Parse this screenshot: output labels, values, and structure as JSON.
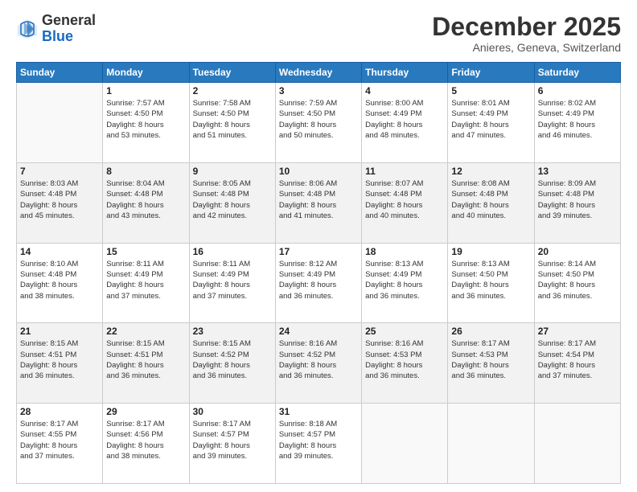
{
  "logo": {
    "general": "General",
    "blue": "Blue"
  },
  "title": "December 2025",
  "subtitle": "Anieres, Geneva, Switzerland",
  "days_header": [
    "Sunday",
    "Monday",
    "Tuesday",
    "Wednesday",
    "Thursday",
    "Friday",
    "Saturday"
  ],
  "weeks": [
    {
      "shaded": false,
      "days": [
        {
          "num": "",
          "empty": true
        },
        {
          "num": "1",
          "sunrise": "Sunrise: 7:57 AM",
          "sunset": "Sunset: 4:50 PM",
          "daylight": "Daylight: 8 hours",
          "daylight2": "and 53 minutes."
        },
        {
          "num": "2",
          "sunrise": "Sunrise: 7:58 AM",
          "sunset": "Sunset: 4:50 PM",
          "daylight": "Daylight: 8 hours",
          "daylight2": "and 51 minutes."
        },
        {
          "num": "3",
          "sunrise": "Sunrise: 7:59 AM",
          "sunset": "Sunset: 4:50 PM",
          "daylight": "Daylight: 8 hours",
          "daylight2": "and 50 minutes."
        },
        {
          "num": "4",
          "sunrise": "Sunrise: 8:00 AM",
          "sunset": "Sunset: 4:49 PM",
          "daylight": "Daylight: 8 hours",
          "daylight2": "and 48 minutes."
        },
        {
          "num": "5",
          "sunrise": "Sunrise: 8:01 AM",
          "sunset": "Sunset: 4:49 PM",
          "daylight": "Daylight: 8 hours",
          "daylight2": "and 47 minutes."
        },
        {
          "num": "6",
          "sunrise": "Sunrise: 8:02 AM",
          "sunset": "Sunset: 4:49 PM",
          "daylight": "Daylight: 8 hours",
          "daylight2": "and 46 minutes."
        }
      ]
    },
    {
      "shaded": true,
      "days": [
        {
          "num": "7",
          "sunrise": "Sunrise: 8:03 AM",
          "sunset": "Sunset: 4:48 PM",
          "daylight": "Daylight: 8 hours",
          "daylight2": "and 45 minutes."
        },
        {
          "num": "8",
          "sunrise": "Sunrise: 8:04 AM",
          "sunset": "Sunset: 4:48 PM",
          "daylight": "Daylight: 8 hours",
          "daylight2": "and 43 minutes."
        },
        {
          "num": "9",
          "sunrise": "Sunrise: 8:05 AM",
          "sunset": "Sunset: 4:48 PM",
          "daylight": "Daylight: 8 hours",
          "daylight2": "and 42 minutes."
        },
        {
          "num": "10",
          "sunrise": "Sunrise: 8:06 AM",
          "sunset": "Sunset: 4:48 PM",
          "daylight": "Daylight: 8 hours",
          "daylight2": "and 41 minutes."
        },
        {
          "num": "11",
          "sunrise": "Sunrise: 8:07 AM",
          "sunset": "Sunset: 4:48 PM",
          "daylight": "Daylight: 8 hours",
          "daylight2": "and 40 minutes."
        },
        {
          "num": "12",
          "sunrise": "Sunrise: 8:08 AM",
          "sunset": "Sunset: 4:48 PM",
          "daylight": "Daylight: 8 hours",
          "daylight2": "and 40 minutes."
        },
        {
          "num": "13",
          "sunrise": "Sunrise: 8:09 AM",
          "sunset": "Sunset: 4:48 PM",
          "daylight": "Daylight: 8 hours",
          "daylight2": "and 39 minutes."
        }
      ]
    },
    {
      "shaded": false,
      "days": [
        {
          "num": "14",
          "sunrise": "Sunrise: 8:10 AM",
          "sunset": "Sunset: 4:48 PM",
          "daylight": "Daylight: 8 hours",
          "daylight2": "and 38 minutes."
        },
        {
          "num": "15",
          "sunrise": "Sunrise: 8:11 AM",
          "sunset": "Sunset: 4:49 PM",
          "daylight": "Daylight: 8 hours",
          "daylight2": "and 37 minutes."
        },
        {
          "num": "16",
          "sunrise": "Sunrise: 8:11 AM",
          "sunset": "Sunset: 4:49 PM",
          "daylight": "Daylight: 8 hours",
          "daylight2": "and 37 minutes."
        },
        {
          "num": "17",
          "sunrise": "Sunrise: 8:12 AM",
          "sunset": "Sunset: 4:49 PM",
          "daylight": "Daylight: 8 hours",
          "daylight2": "and 36 minutes."
        },
        {
          "num": "18",
          "sunrise": "Sunrise: 8:13 AM",
          "sunset": "Sunset: 4:49 PM",
          "daylight": "Daylight: 8 hours",
          "daylight2": "and 36 minutes."
        },
        {
          "num": "19",
          "sunrise": "Sunrise: 8:13 AM",
          "sunset": "Sunset: 4:50 PM",
          "daylight": "Daylight: 8 hours",
          "daylight2": "and 36 minutes."
        },
        {
          "num": "20",
          "sunrise": "Sunrise: 8:14 AM",
          "sunset": "Sunset: 4:50 PM",
          "daylight": "Daylight: 8 hours",
          "daylight2": "and 36 minutes."
        }
      ]
    },
    {
      "shaded": true,
      "days": [
        {
          "num": "21",
          "sunrise": "Sunrise: 8:15 AM",
          "sunset": "Sunset: 4:51 PM",
          "daylight": "Daylight: 8 hours",
          "daylight2": "and 36 minutes."
        },
        {
          "num": "22",
          "sunrise": "Sunrise: 8:15 AM",
          "sunset": "Sunset: 4:51 PM",
          "daylight": "Daylight: 8 hours",
          "daylight2": "and 36 minutes."
        },
        {
          "num": "23",
          "sunrise": "Sunrise: 8:15 AM",
          "sunset": "Sunset: 4:52 PM",
          "daylight": "Daylight: 8 hours",
          "daylight2": "and 36 minutes."
        },
        {
          "num": "24",
          "sunrise": "Sunrise: 8:16 AM",
          "sunset": "Sunset: 4:52 PM",
          "daylight": "Daylight: 8 hours",
          "daylight2": "and 36 minutes."
        },
        {
          "num": "25",
          "sunrise": "Sunrise: 8:16 AM",
          "sunset": "Sunset: 4:53 PM",
          "daylight": "Daylight: 8 hours",
          "daylight2": "and 36 minutes."
        },
        {
          "num": "26",
          "sunrise": "Sunrise: 8:17 AM",
          "sunset": "Sunset: 4:53 PM",
          "daylight": "Daylight: 8 hours",
          "daylight2": "and 36 minutes."
        },
        {
          "num": "27",
          "sunrise": "Sunrise: 8:17 AM",
          "sunset": "Sunset: 4:54 PM",
          "daylight": "Daylight: 8 hours",
          "daylight2": "and 37 minutes."
        }
      ]
    },
    {
      "shaded": false,
      "days": [
        {
          "num": "28",
          "sunrise": "Sunrise: 8:17 AM",
          "sunset": "Sunset: 4:55 PM",
          "daylight": "Daylight: 8 hours",
          "daylight2": "and 37 minutes."
        },
        {
          "num": "29",
          "sunrise": "Sunrise: 8:17 AM",
          "sunset": "Sunset: 4:56 PM",
          "daylight": "Daylight: 8 hours",
          "daylight2": "and 38 minutes."
        },
        {
          "num": "30",
          "sunrise": "Sunrise: 8:17 AM",
          "sunset": "Sunset: 4:57 PM",
          "daylight": "Daylight: 8 hours",
          "daylight2": "and 39 minutes."
        },
        {
          "num": "31",
          "sunrise": "Sunrise: 8:18 AM",
          "sunset": "Sunset: 4:57 PM",
          "daylight": "Daylight: 8 hours",
          "daylight2": "and 39 minutes."
        },
        {
          "num": "",
          "empty": true
        },
        {
          "num": "",
          "empty": true
        },
        {
          "num": "",
          "empty": true
        }
      ]
    }
  ]
}
